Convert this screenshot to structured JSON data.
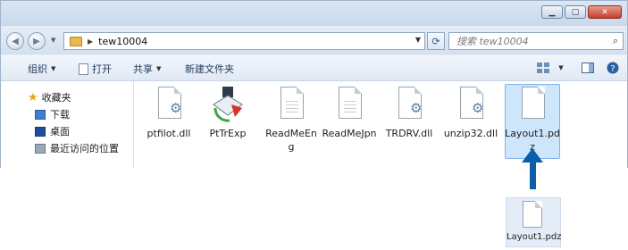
{
  "address": {
    "path": "tew10004"
  },
  "search": {
    "placeholder": "搜索 tew10004"
  },
  "toolbar": {
    "organize": "组织",
    "open": "打开",
    "share": "共享",
    "new_folder": "新建文件夹"
  },
  "sidebar": {
    "favorites": "收藏夹",
    "items": [
      {
        "label": "下载"
      },
      {
        "label": "桌面"
      },
      {
        "label": "最近访问的位置"
      }
    ]
  },
  "files": [
    {
      "name": "ptfilot.dll"
    },
    {
      "name": "PtTrExp"
    },
    {
      "name": "ReadMeEng"
    },
    {
      "name": "ReadMeJpn"
    },
    {
      "name": "TRDRV.dll"
    },
    {
      "name": "unzip32.dll"
    },
    {
      "name": "Layout1.pdz"
    }
  ],
  "callout": {
    "file_name": "Layout1.pdz"
  },
  "colors": {
    "arrow": "#0b5fa8",
    "selection": "#cde6fb",
    "close_button": "#c3402b"
  }
}
